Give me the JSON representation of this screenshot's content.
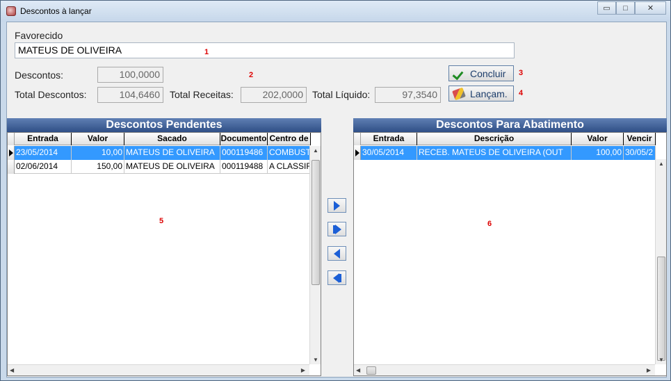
{
  "window": {
    "title": "Descontos à lançar",
    "controls": {
      "minimize": "▭",
      "maximize": "□",
      "close": "✕"
    }
  },
  "favorecido": {
    "label": "Favorecido",
    "value": "MATEUS DE OLIVEIRA"
  },
  "descontos": {
    "label": "Descontos:",
    "value": "100,0000"
  },
  "totals": {
    "total_descontos_label": "Total Descontos:",
    "total_descontos": "104,6460",
    "total_receitas_label": "Total Receitas:",
    "total_receitas": "202,0000",
    "total_liquido_label": "Total Líquido:",
    "total_liquido": "97,3540"
  },
  "buttons": {
    "concluir": "Concluir",
    "lancam": "Lançam."
  },
  "markers": [
    "1",
    "2",
    "3",
    "4",
    "5",
    "6"
  ],
  "pendentes": {
    "title": "Descontos Pendentes",
    "columns": [
      "Entrada",
      "Valor",
      "Sacado",
      "Documento",
      "Centro de"
    ],
    "rows": [
      [
        "23/05/2014",
        "10,00",
        "MATEUS DE OLIVEIRA",
        "000119486",
        "COMBUST"
      ],
      [
        "02/06/2014",
        "150,00",
        "MATEUS DE OLIVEIRA",
        "000119488",
        "A CLASSIFI"
      ]
    ]
  },
  "abatimento": {
    "title": "Descontos Para Abatimento",
    "columns": [
      "Entrada",
      "Descrição",
      "Valor",
      "Vencir"
    ],
    "rows": [
      [
        "30/05/2014",
        "RECEB. MATEUS DE OLIVEIRA (OUT",
        "100,00",
        "30/05/2"
      ]
    ]
  },
  "colors": {
    "accent": "#3399ff",
    "header_bar": "#2f4f86",
    "marker": "#dd0000"
  }
}
